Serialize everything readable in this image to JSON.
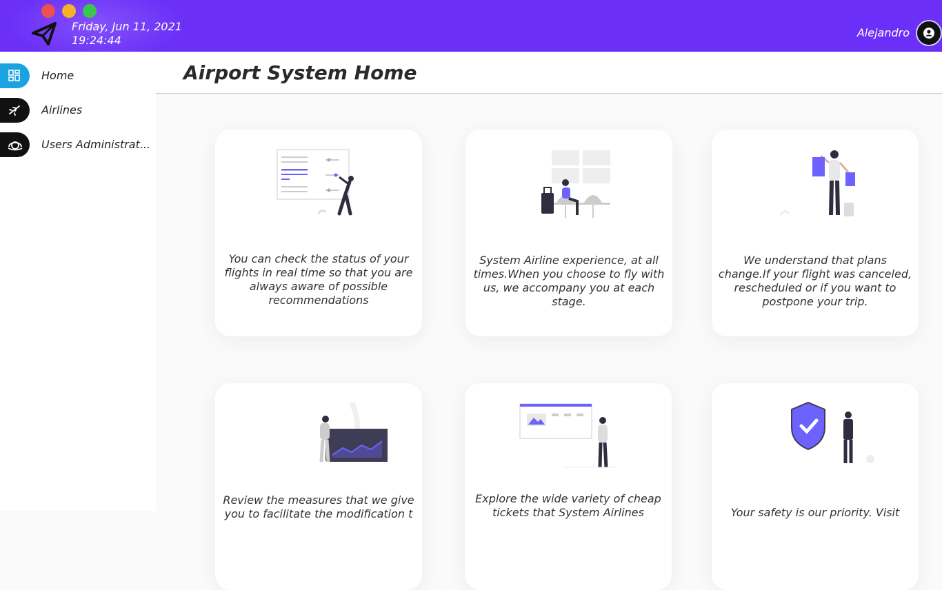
{
  "window": {
    "date": "Friday, Jun 11, 2021",
    "time": "19:24:44",
    "user": "Alejandro",
    "logo_icon": "paper-plane-icon",
    "avatar_icon": "user-circle-icon"
  },
  "colors": {
    "header": "#6b2ff7",
    "active_nav": "#1aa3e0",
    "nav": "#111111",
    "illustration_accent": "#6c63ff"
  },
  "sidebar": {
    "items": [
      {
        "label": "Home",
        "icon": "grid-icon",
        "active": true
      },
      {
        "label": "Airlines",
        "icon": "airplane-icon",
        "active": false
      },
      {
        "label": "Users Administrat...",
        "icon": "users-icon",
        "active": false
      }
    ]
  },
  "main": {
    "title": "Airport System Home",
    "cards": [
      {
        "text": "You can check the status of your flights in real time so that you are always aware of possible recommendations",
        "illustration": "flight-status-board"
      },
      {
        "text": "System Airline experience, at all times.When you choose to fly with us, we accompany you at each stage.",
        "illustration": "waiting-lounge"
      },
      {
        "text": "We understand that plans change.If your flight was canceled, rescheduled or if you want to postpone your trip.",
        "illustration": "shopping-traveler"
      },
      {
        "text": "Review the measures that we give you to facilitate the modification t",
        "illustration": "analytics-chart"
      },
      {
        "text": "Explore the wide variety of cheap tickets that System Airlines",
        "illustration": "browsing-website"
      },
      {
        "text": "Your safety is our priority. Visit",
        "illustration": "security-shield"
      }
    ]
  }
}
